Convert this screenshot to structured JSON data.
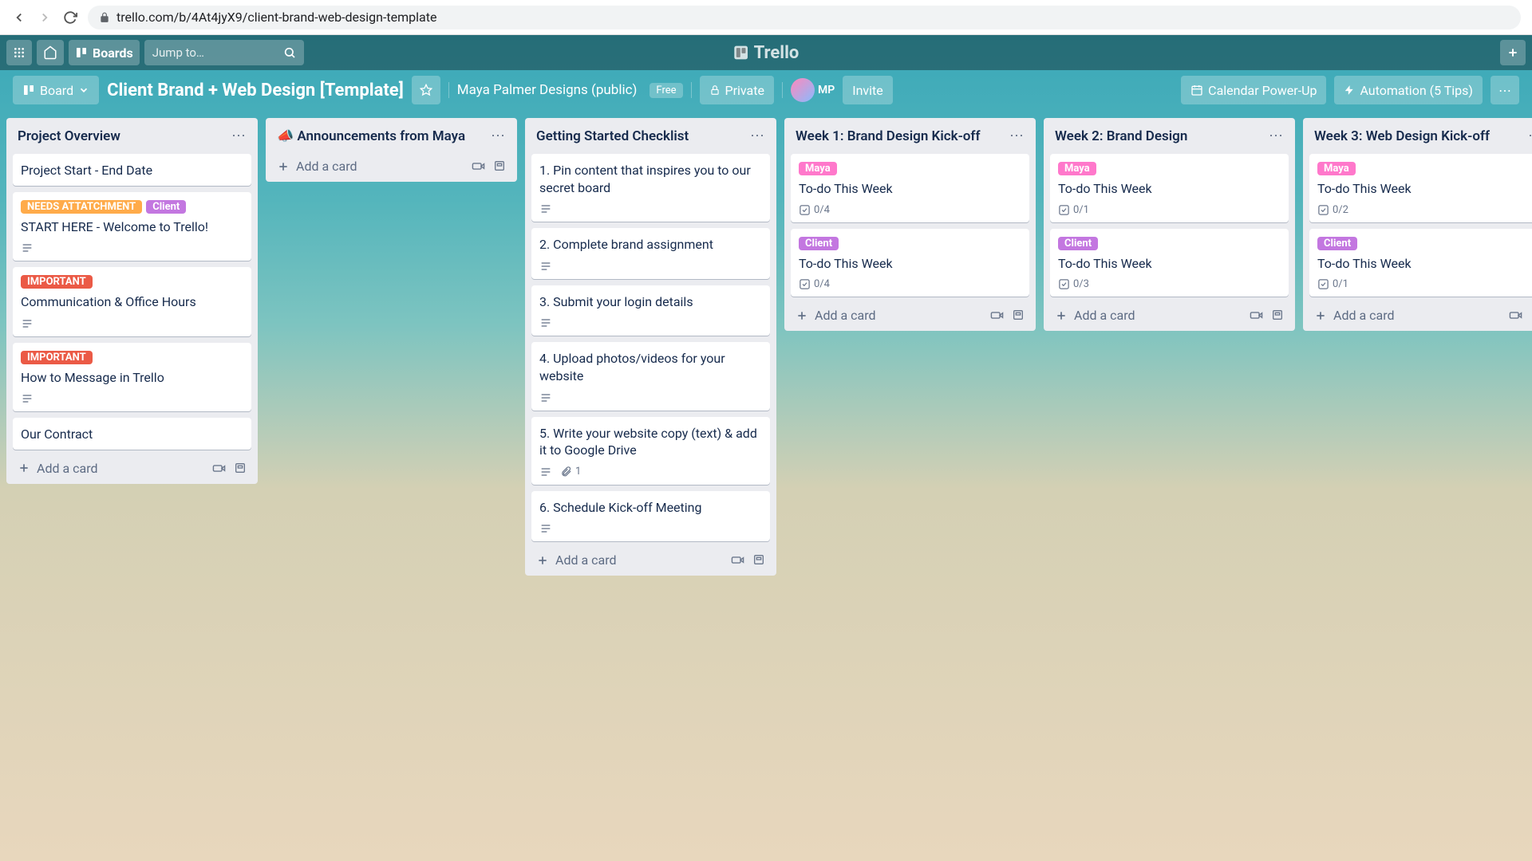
{
  "browser": {
    "url": "trello.com/b/4At4jyX9/client-brand-web-design-template"
  },
  "nav": {
    "boards": "Boards",
    "search_placeholder": "Jump to…",
    "logo": "Trello"
  },
  "header": {
    "board_btn": "Board",
    "title": "Client Brand + Web Design [Template]",
    "workspace": "Maya Palmer Designs (public)",
    "free": "Free",
    "private": "Private",
    "member_initials": "MP",
    "invite": "Invite",
    "calendar": "Calendar Power-Up",
    "automation": "Automation (5 Tips)"
  },
  "labels": {
    "needs_attachment": "NEEDS ATTATCHMENT",
    "client": "Client",
    "maya": "Maya",
    "important": "IMPORTANT"
  },
  "add_card": "Add a card",
  "lists": [
    {
      "title": "Project Overview",
      "cards": [
        {
          "title": "Project Start - End Date"
        },
        {
          "title": "START HERE - Welcome to Trello!",
          "labels": [
            "needs_attachment",
            "client"
          ],
          "desc": true
        },
        {
          "title": "Communication & Office Hours",
          "labels": [
            "important"
          ],
          "desc": true
        },
        {
          "title": "How to Message in Trello",
          "labels": [
            "important"
          ],
          "desc": true
        },
        {
          "title": "Our Contract"
        }
      ]
    },
    {
      "title": "📣 Announcements from Maya",
      "cards": []
    },
    {
      "title": "Getting Started Checklist",
      "cards": [
        {
          "title": "1. Pin content that inspires you to our secret board",
          "desc": true
        },
        {
          "title": "2. Complete brand assignment",
          "desc": true
        },
        {
          "title": "3. Submit your login details",
          "desc": true
        },
        {
          "title": "4. Upload photos/videos for your website",
          "desc": true
        },
        {
          "title": "5. Write your website copy (text) & add it to Google Drive",
          "desc": true,
          "attach": "1"
        },
        {
          "title": "6. Schedule Kick-off Meeting",
          "desc": true
        }
      ]
    },
    {
      "title": "Week 1: Brand Design Kick-off",
      "cards": [
        {
          "title": "To-do This Week",
          "labels": [
            "maya"
          ],
          "check": "0/4"
        },
        {
          "title": "To-do This Week",
          "labels": [
            "client"
          ],
          "check": "0/4"
        }
      ]
    },
    {
      "title": "Week 2: Brand Design",
      "cards": [
        {
          "title": "To-do This Week",
          "labels": [
            "maya"
          ],
          "check": "0/1"
        },
        {
          "title": "To-do This Week",
          "labels": [
            "client"
          ],
          "check": "0/3"
        }
      ]
    },
    {
      "title": "Week 3: Web Design Kick-off",
      "cards": [
        {
          "title": "To-do This Week",
          "labels": [
            "maya"
          ],
          "check": "0/2"
        },
        {
          "title": "To-do This Week",
          "labels": [
            "client"
          ],
          "check": "0/1"
        }
      ]
    }
  ]
}
